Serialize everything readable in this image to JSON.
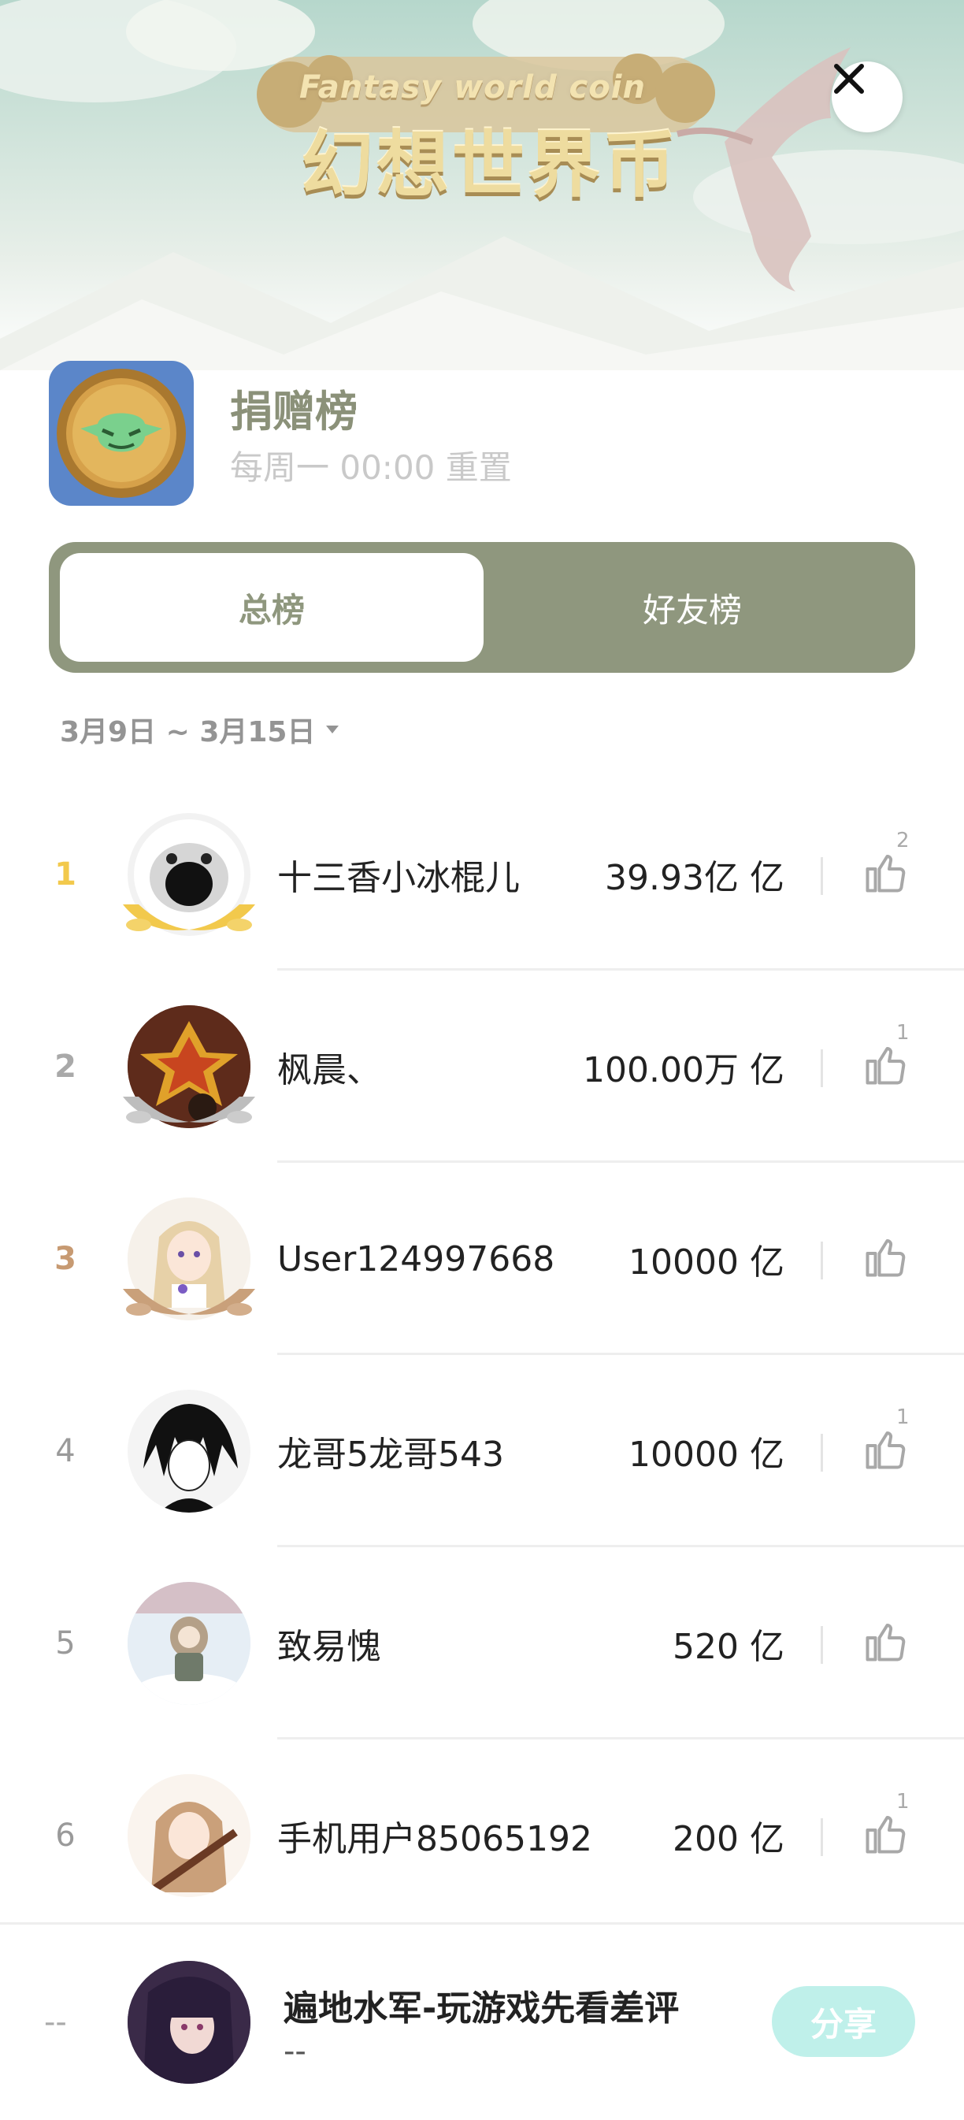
{
  "banner": {
    "title_en": "Fantasy world coin",
    "title_zh": "幻想世界币"
  },
  "header": {
    "title": "捐赠榜",
    "subtitle": "每周一 00:00 重置"
  },
  "tabs": [
    {
      "label": "总榜",
      "active": true
    },
    {
      "label": "好友榜",
      "active": false
    }
  ],
  "date_range": "3月9日 ~ 3月15日",
  "rows": [
    {
      "rank": "1",
      "name": "十三香小冰棍儿",
      "amount": "39.93亿 亿",
      "likes": "2",
      "rank_color": "#f2c94c"
    },
    {
      "rank": "2",
      "name": "枫晨、",
      "amount": "100.00万 亿",
      "likes": "1",
      "rank_color": "#a9a9a9"
    },
    {
      "rank": "3",
      "name": "User124997668",
      "amount": "10000 亿",
      "likes": "",
      "rank_color": "#c79a72"
    },
    {
      "rank": "4",
      "name": "龙哥5龙哥543",
      "amount": "10000 亿",
      "likes": "1",
      "rank_color": "#9a9a9a"
    },
    {
      "rank": "5",
      "name": "致易愧",
      "amount": "520 亿",
      "likes": "",
      "rank_color": "#9a9a9a"
    },
    {
      "rank": "6",
      "name": "手机用户85065192",
      "amount": "200 亿",
      "likes": "1",
      "rank_color": "#9a9a9a"
    }
  ],
  "me": {
    "rank": "--",
    "name": "遍地水军-玩游戏先看差评",
    "amount": "--",
    "share_label": "分享"
  },
  "colors": {
    "accent": "#8f977e",
    "gold": "#f2c94c",
    "silver": "#a9a9a9",
    "bronze": "#c79a72",
    "share": "#bff0ea"
  }
}
